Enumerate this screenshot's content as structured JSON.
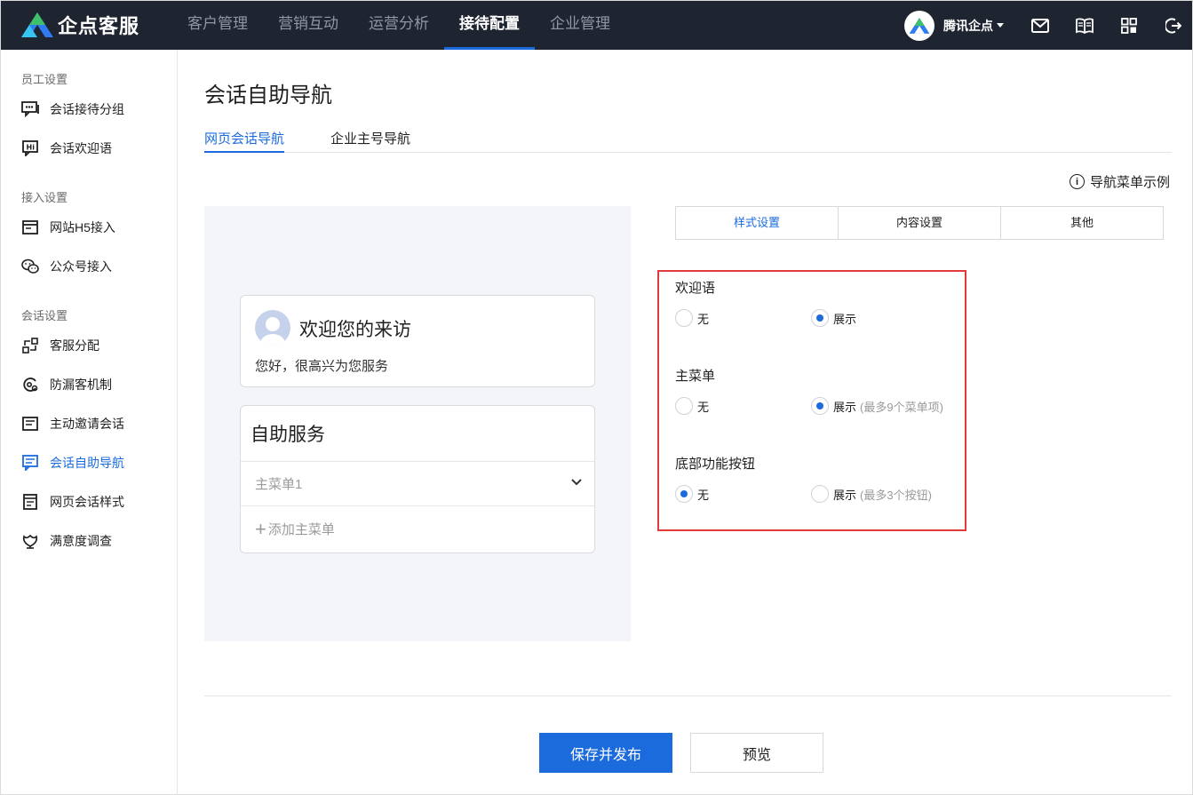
{
  "brand": {
    "name": "企点客服",
    "logo_icon": "triangle-logo-icon",
    "accent": "#1c6bdd"
  },
  "nav": {
    "items": [
      {
        "label": "客户管理"
      },
      {
        "label": "营销互动"
      },
      {
        "label": "运营分析"
      },
      {
        "label": "接待配置",
        "active": true
      },
      {
        "label": "企业管理"
      }
    ]
  },
  "account": {
    "name": "腾讯企点",
    "icons": [
      "mail-icon",
      "book-icon",
      "apps-grid-icon",
      "logout-icon"
    ]
  },
  "sidebar": {
    "groups": [
      {
        "label": "员工设置"
      },
      {
        "label": "接入设置"
      },
      {
        "label": "会话设置"
      }
    ],
    "items": [
      {
        "label": "会话接待分组",
        "icon": "chat-group-icon"
      },
      {
        "label": "会话欢迎语",
        "icon": "hi-message-icon"
      },
      {
        "label": "网站H5接入",
        "icon": "web-window-icon"
      },
      {
        "label": "公众号接入",
        "icon": "wechat-icon"
      },
      {
        "label": "客服分配",
        "icon": "distribute-icon"
      },
      {
        "label": "防漏客机制",
        "icon": "anti-loss-icon"
      },
      {
        "label": "主动邀请会话",
        "icon": "invite-icon"
      },
      {
        "label": "会话自助导航",
        "icon": "self-nav-icon",
        "active": true
      },
      {
        "label": "网页会话样式",
        "icon": "page-style-icon"
      },
      {
        "label": "满意度调查",
        "icon": "satisfaction-icon"
      }
    ]
  },
  "page": {
    "title": "会话自助导航",
    "tabs": [
      {
        "label": "网页会话导航",
        "active": true
      },
      {
        "label": "企业主号导航"
      }
    ],
    "nav_example": "导航菜单示例"
  },
  "preview": {
    "welcome_title": "欢迎您的来访",
    "welcome_text": "您好，很高兴为您服务",
    "service_title": "自助服务",
    "menu_item": "主菜单1",
    "add_menu": "添加主菜单"
  },
  "settings": {
    "segments": [
      {
        "label": "样式设置",
        "active": true
      },
      {
        "label": "内容设置"
      },
      {
        "label": "其他"
      }
    ],
    "welcome": {
      "label": "欢迎语",
      "opt_none": "无",
      "opt_show": "展示",
      "hint": "",
      "selected": "show"
    },
    "main_menu": {
      "label": "主菜单",
      "opt_none": "无",
      "opt_show": "展示",
      "hint": "(最多9个菜单项)",
      "selected": "show"
    },
    "bottom_buttons": {
      "label": "底部功能按钮",
      "opt_none": "无",
      "opt_show": "展示",
      "hint": "(最多3个按钮)",
      "selected": "none"
    }
  },
  "footer": {
    "save_label": "保存并发布",
    "preview_label": "预览"
  }
}
